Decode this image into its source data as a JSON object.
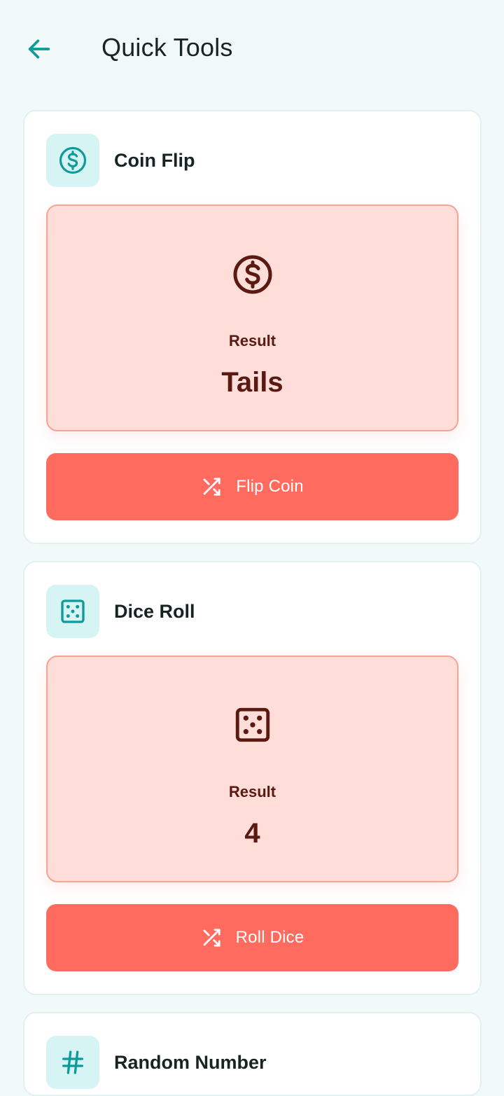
{
  "app_bar": {
    "title": "Quick Tools",
    "back_icon": "arrow-left-icon"
  },
  "colors": {
    "accent": "#0f9a9a",
    "tool_icon_bg": "#d6f4f4",
    "result_bg": "#ffddd9",
    "result_border": "#f6a396",
    "result_text": "#5a1a12",
    "button_bg": "#ff6b5f"
  },
  "tools": [
    {
      "name": "Coin Flip",
      "icon": "dollar-circle-icon",
      "result_label": "Result",
      "result_value": "Tails",
      "button_label": "Flip Coin",
      "button_icon": "shuffle-icon"
    },
    {
      "name": "Dice Roll",
      "icon": "dice-five-icon",
      "result_label": "Result",
      "result_value": "4",
      "button_label": "Roll Dice",
      "button_icon": "shuffle-icon"
    },
    {
      "name": "Random Number",
      "icon": "hash-icon"
    }
  ]
}
